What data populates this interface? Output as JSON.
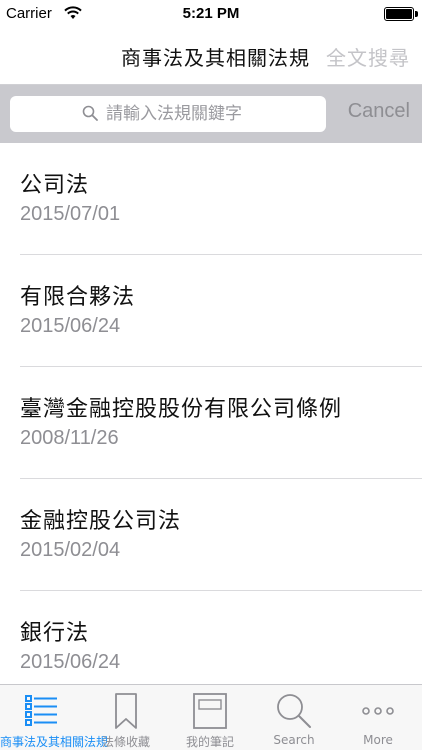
{
  "status": {
    "carrier": "Carrier",
    "time": "5:21 PM"
  },
  "nav": {
    "title": "商事法及其相關法規",
    "action": "全文搜尋"
  },
  "search": {
    "placeholder": "請輸入法規關鍵字",
    "cancel": "Cancel"
  },
  "laws": [
    {
      "title": "公司法",
      "date": "2015/07/01"
    },
    {
      "title": "有限合夥法",
      "date": "2015/06/24"
    },
    {
      "title": "臺灣金融控股股份有限公司條例",
      "date": "2008/11/26"
    },
    {
      "title": "金融控股公司法",
      "date": "2015/02/04"
    },
    {
      "title": "銀行法",
      "date": "2015/06/24"
    }
  ],
  "tabs": [
    {
      "label": "商事法及其相關法規",
      "icon": "list-icon",
      "active": true
    },
    {
      "label": "法條收藏",
      "icon": "bookmark-icon"
    },
    {
      "label": "我的筆記",
      "icon": "notebook-icon"
    },
    {
      "label": "Search",
      "icon": "search-icon"
    },
    {
      "label": "More",
      "icon": "more-icon"
    }
  ],
  "colors": {
    "accent": "#1a8ef5",
    "inactive": "#8e8e93",
    "search_bg": "#c9c9ce"
  }
}
